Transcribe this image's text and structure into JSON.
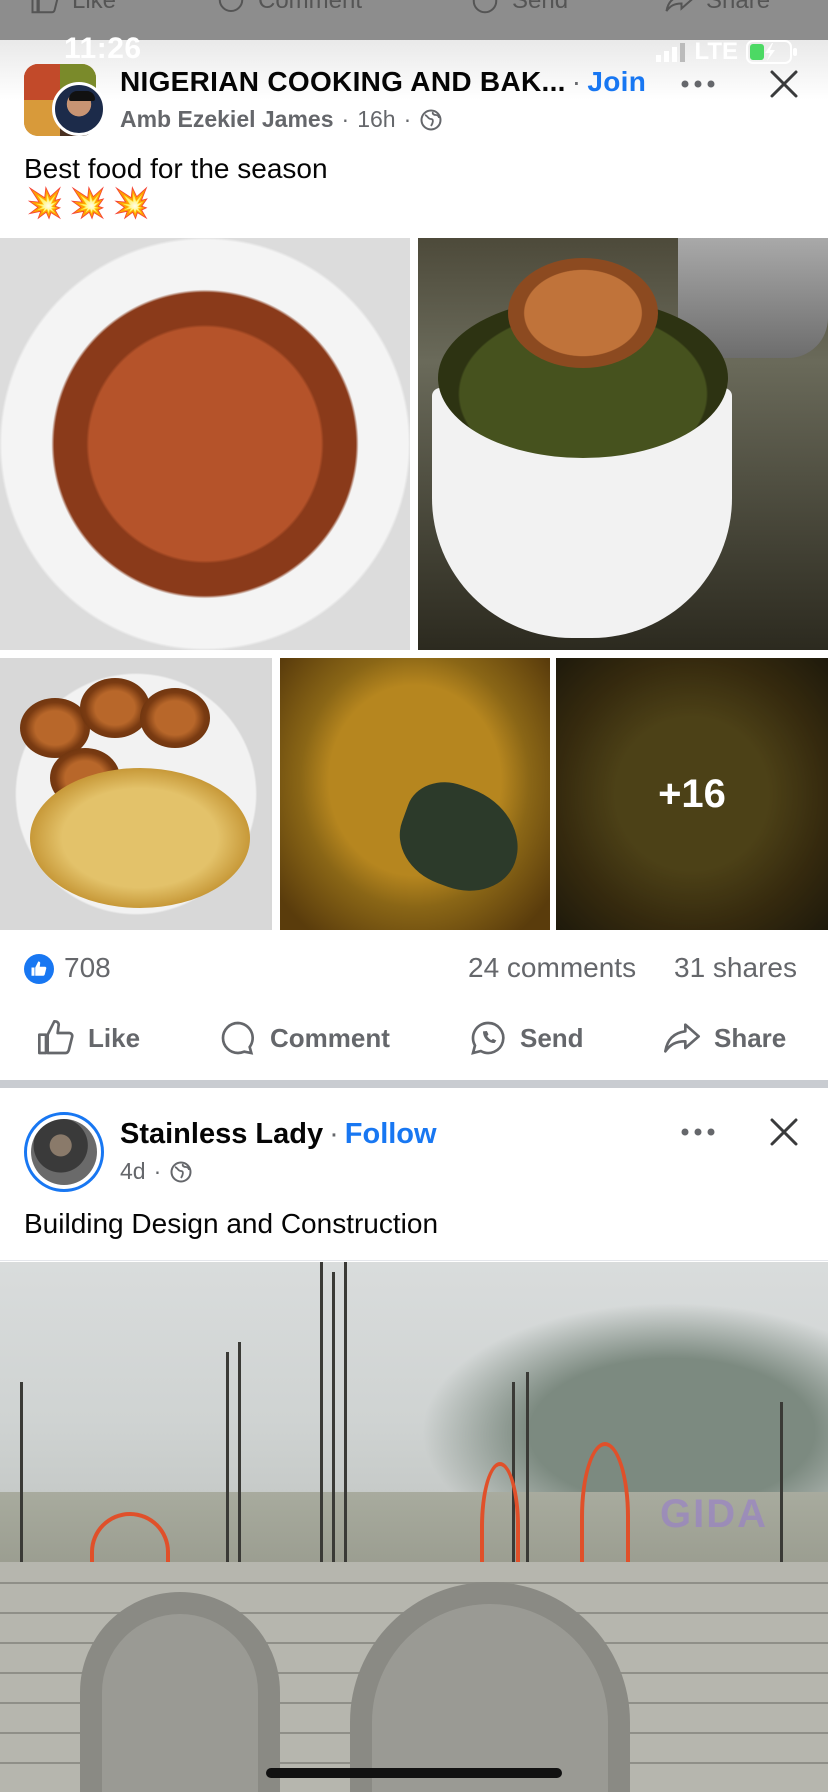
{
  "status_bar": {
    "time": "11:26",
    "network": "LTE"
  },
  "prev_post_actions": [
    "Like",
    "Comment",
    "Send",
    "Share"
  ],
  "post1": {
    "group_name": "NIGERIAN COOKING AND BAK...",
    "join_label": "Join",
    "author": "Amb Ezekiel James",
    "time": "16h",
    "text": "Best food for the season",
    "emoji": "💥💥💥",
    "photo_overflow": "+16",
    "like_count": "708",
    "comments": "24 comments",
    "shares": "31 shares",
    "actions": {
      "like": "Like",
      "comment": "Comment",
      "send": "Send",
      "share": "Share"
    }
  },
  "post2": {
    "name": "Stainless Lady",
    "follow_label": "Follow",
    "time": "4d",
    "text": "Building Design and Construction"
  },
  "colors": {
    "accent": "#1877f2",
    "muted": "#65676b",
    "separator": "#c9ccd1"
  },
  "icons": [
    "like-icon",
    "comment-icon",
    "whatsapp-icon",
    "share-icon",
    "globe-icon",
    "more-icon",
    "close-icon",
    "signal-icon",
    "battery-icon"
  ]
}
